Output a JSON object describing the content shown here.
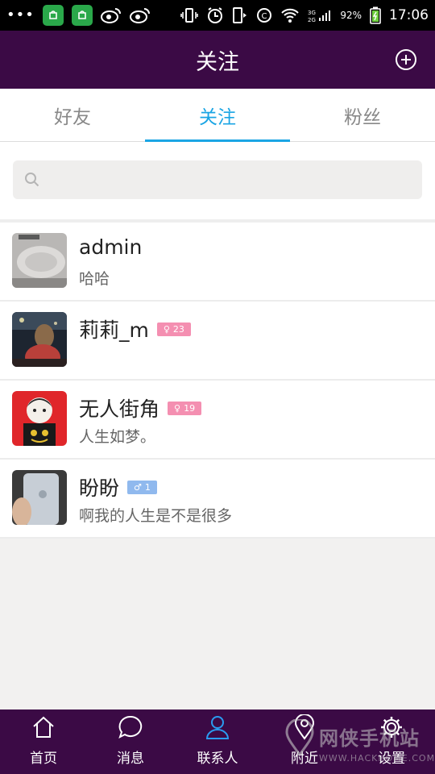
{
  "status_bar": {
    "time": "17:06",
    "battery": "92%",
    "icons": [
      "more-dots-icon",
      "app-green-icon",
      "app-green-icon",
      "weibo-icon",
      "weibo-icon",
      "vibrate-icon",
      "alarm-icon",
      "phone-icon",
      "data-icon",
      "wifi-icon",
      "signal-icon",
      "battery-icon"
    ]
  },
  "header": {
    "title": "关注",
    "add_icon": "plus-circle-icon"
  },
  "tabs": [
    {
      "label": "好友",
      "active": false
    },
    {
      "label": "关注",
      "active": true
    },
    {
      "label": "粉丝",
      "active": false
    }
  ],
  "search": {
    "placeholder": "",
    "value": ""
  },
  "contacts": [
    {
      "name": "admin",
      "status": "哈哈",
      "badge": null
    },
    {
      "name": "莉莉_m",
      "status": "",
      "badge": {
        "gender": "female",
        "symbol": "♀",
        "age": "23"
      }
    },
    {
      "name": "无人街角",
      "status": "人生如梦。",
      "badge": {
        "gender": "female",
        "symbol": "♀",
        "age": "19"
      }
    },
    {
      "name": "盼盼",
      "status": "啊我的人生是不是很多",
      "badge": {
        "gender": "male",
        "symbol": "♂",
        "age": "1"
      }
    }
  ],
  "bottom_nav": [
    {
      "label": "首页",
      "icon": "home-icon",
      "active": false
    },
    {
      "label": "消息",
      "icon": "chat-icon",
      "active": false
    },
    {
      "label": "联系人",
      "icon": "person-icon",
      "active": true
    },
    {
      "label": "附近",
      "icon": "location-icon",
      "active": false
    },
    {
      "label": "设置",
      "icon": "gear-icon",
      "active": false
    }
  ],
  "watermark": {
    "main": "网侠手机站",
    "sub": "WWW.HACKHOME.COM"
  },
  "colors": {
    "header_bg": "#3b0a45",
    "accent": "#1ba5e4",
    "female_badge": "#f48fb1",
    "male_badge": "#90b9ee"
  }
}
